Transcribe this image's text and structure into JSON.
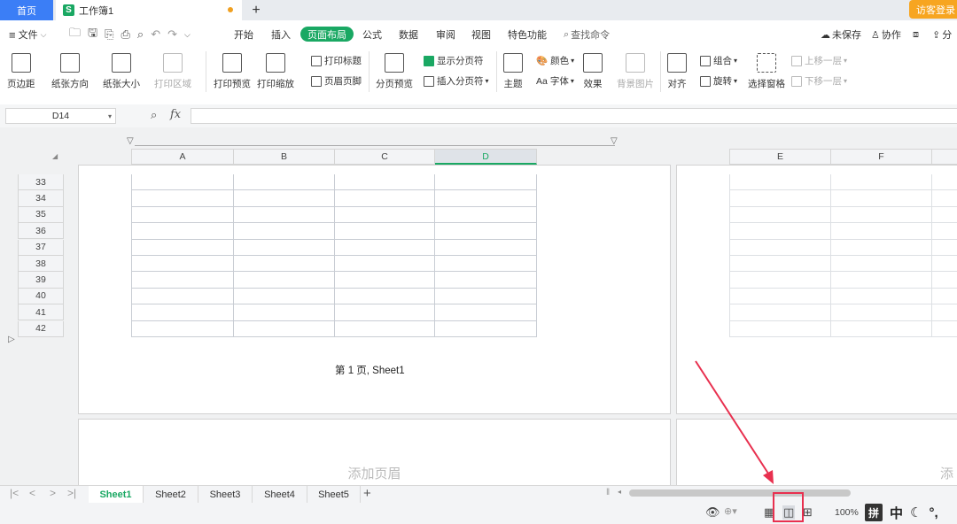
{
  "tabs": {
    "home": "首页",
    "document": "工作簿1",
    "new_tab": "+",
    "guest_login": "访客登录"
  },
  "menubar": {
    "file": "文件",
    "items": [
      "开始",
      "插入",
      "页面布局",
      "公式",
      "数据",
      "审阅",
      "视图",
      "特色功能"
    ],
    "active": "页面布局",
    "search": "查找命令",
    "unsaved": "未保存",
    "collab": "协作",
    "share": "分"
  },
  "ribbon": {
    "margins": "页边距",
    "orientation": "纸张方向",
    "size": "纸张大小",
    "print_area": "打印区域",
    "print_preview": "打印预览",
    "print_scaling": "打印缩放",
    "print_titles": "打印标题",
    "header_footer": "页眉页脚",
    "page_break_preview": "分页预览",
    "show_page_breaks": "显示分页符",
    "insert_page_break": "插入分页符",
    "theme": "主题",
    "colors": "颜色",
    "fonts": "字体",
    "effects": "效果",
    "background": "背景图片",
    "align": "对齐",
    "group": "组合",
    "rotate": "旋转",
    "selection_pane": "选择窗格",
    "bring_forward": "上移一层",
    "send_backward": "下移一层"
  },
  "formula": {
    "namebox": "D14",
    "fx": "fx",
    "value": ""
  },
  "grid": {
    "columns_page1": [
      "A",
      "B",
      "C",
      "D"
    ],
    "columns_page2": [
      "E",
      "F"
    ],
    "selected_column": "D",
    "rows": [
      "33",
      "34",
      "35",
      "36",
      "37",
      "38",
      "39",
      "40",
      "41",
      "42"
    ]
  },
  "page_footer": "第 1 页, Sheet1",
  "add_header": "添加页眉",
  "add_header_partial": "添",
  "sheets": [
    "Sheet1",
    "Sheet2",
    "Sheet3",
    "Sheet4",
    "Sheet5"
  ],
  "active_sheet": "Sheet1",
  "status": {
    "zoom": "100%",
    "ime": [
      "拼",
      "中"
    ]
  }
}
